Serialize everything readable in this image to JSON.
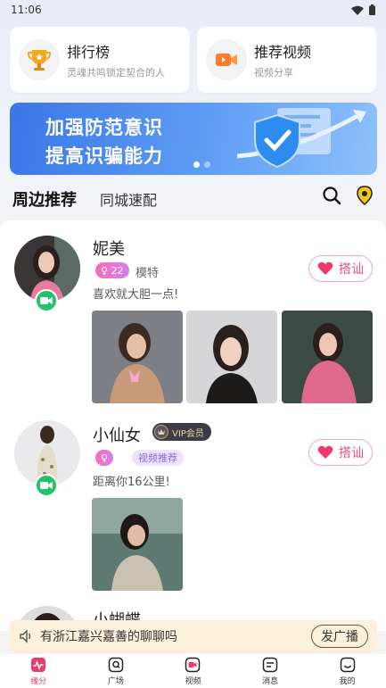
{
  "status_bar": {
    "time": "11:06"
  },
  "features": [
    {
      "title": "排行榜",
      "subtitle": "灵魂共鸣锁定契合的人",
      "icon": "trophy-icon"
    },
    {
      "title": "推荐视频",
      "subtitle": "视频分享",
      "icon": "video-camera-icon"
    }
  ],
  "banner": {
    "line1": "加强防范意识",
    "line2": "提高识骗能力"
  },
  "tabs": {
    "active": "周边推荐",
    "other": "同城速配"
  },
  "users": [
    {
      "name": "妮美",
      "age": "22",
      "gender_symbol": "♀",
      "occupation": "模特",
      "bio": "喜欢就大胆一点!",
      "chat_label": "搭讪"
    },
    {
      "name": "小仙女",
      "vip_label": "VIP会员",
      "gender_symbol": "♀",
      "tag": "视频推荐",
      "bio": "距离你16公里!",
      "chat_label": "搭讪"
    },
    {
      "name": "小蝴蝶"
    }
  ],
  "broadcast": {
    "text": "有浙江嘉兴嘉善的聊聊吗",
    "button": "发广播"
  },
  "nav": [
    {
      "label": "缘分",
      "active": true
    },
    {
      "label": "广场"
    },
    {
      "label": "视频"
    },
    {
      "label": "消息"
    },
    {
      "label": "我的"
    }
  ],
  "colors": {
    "accent": "#ec3a6a",
    "video_badge": "#21c36b",
    "banner": "#3a76e6"
  }
}
